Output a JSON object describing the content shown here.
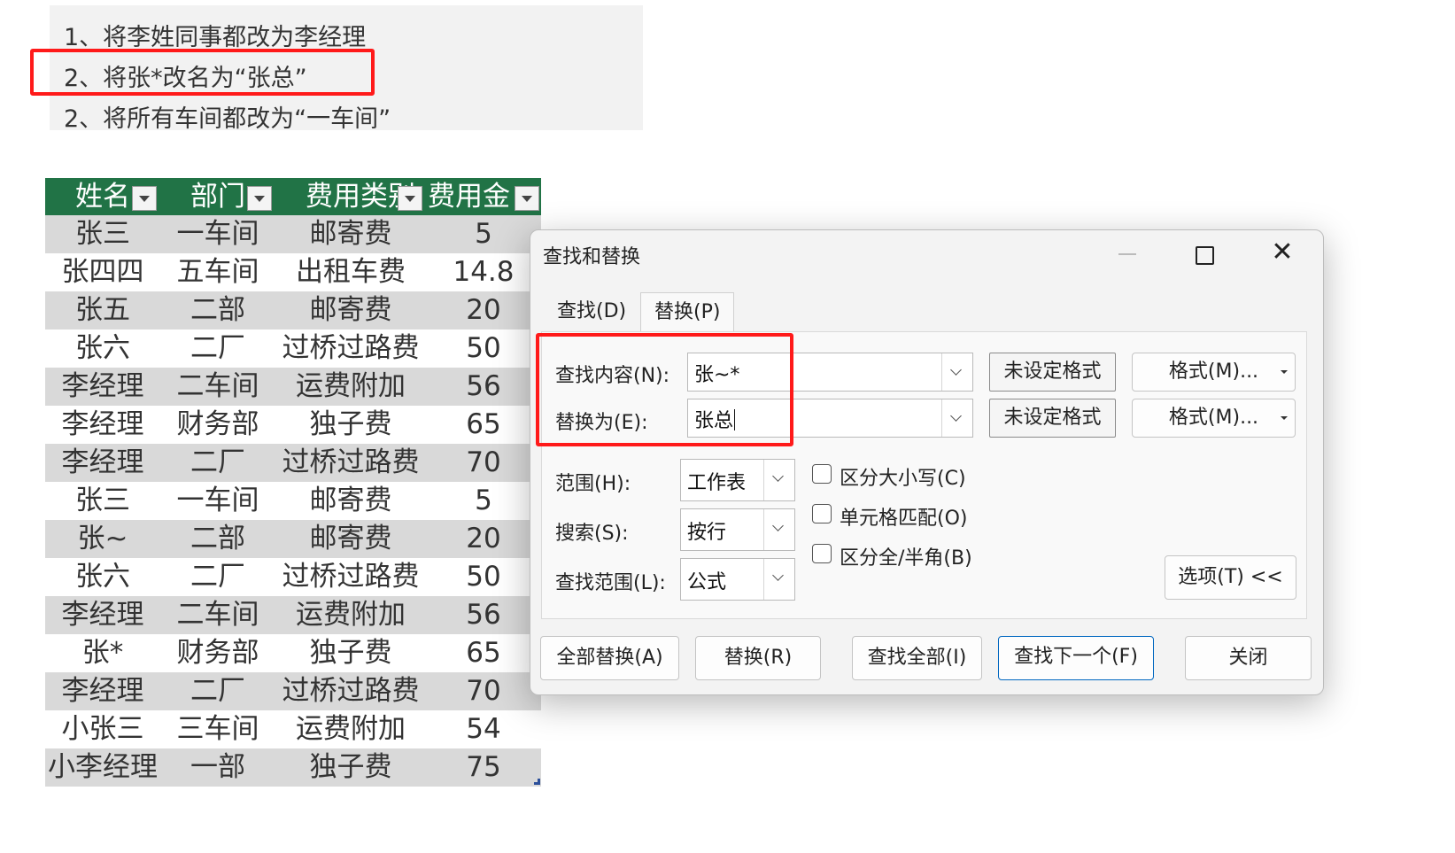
{
  "instructions": {
    "line1": "1、将李姓同事都改为李经理",
    "line2": "2、将张*改名为“张总”",
    "line3": "2、将所有车间都改为“一车间”"
  },
  "table": {
    "headers": [
      "姓名",
      "部门",
      "费用类别",
      "费用金"
    ],
    "rows": [
      [
        "张三",
        "一车间",
        "邮寄费",
        "5"
      ],
      [
        "张四四",
        "五车间",
        "出租车费",
        "14.8"
      ],
      [
        "张五",
        "二部",
        "邮寄费",
        "20"
      ],
      [
        "张六",
        "二厂",
        "过桥过路费",
        "50"
      ],
      [
        "李经理",
        "二车间",
        "运费附加",
        "56"
      ],
      [
        "李经理",
        "财务部",
        "独子费",
        "65"
      ],
      [
        "李经理",
        "二厂",
        "过桥过路费",
        "70"
      ],
      [
        "张三",
        "一车间",
        "邮寄费",
        "5"
      ],
      [
        "张~",
        "二部",
        "邮寄费",
        "20"
      ],
      [
        "张六",
        "二厂",
        "过桥过路费",
        "50"
      ],
      [
        "李经理",
        "二车间",
        "运费附加",
        "56"
      ],
      [
        "张*",
        "财务部",
        "独子费",
        "65"
      ],
      [
        "李经理",
        "二厂",
        "过桥过路费",
        "70"
      ],
      [
        "小张三",
        "三车间",
        "运费附加",
        "54"
      ],
      [
        "小李经理",
        "一部",
        "独子费",
        "75"
      ]
    ],
    "header_color": "#217346",
    "band_color": "#d9d9d9"
  },
  "dialog": {
    "title": "查找和替换",
    "tabs": {
      "find": "查找(D)",
      "replace": "替换(P)"
    },
    "find_label": "查找内容(N):",
    "find_value": "张~*",
    "replace_label": "替换为(E):",
    "replace_value": "张总",
    "no_format": "未设定格式",
    "format_button": "格式(M)...",
    "scope_label": "范围(H):",
    "scope_value": "工作表",
    "search_label": "搜索(S):",
    "search_value": "按行",
    "lookin_label": "查找范围(L):",
    "lookin_value": "公式",
    "match_case": "区分大小写(C)",
    "match_cell": "单元格匹配(O)",
    "match_width": "区分全/半角(B)",
    "options_button": "选项(T) <<",
    "replace_all": "全部替换(A)",
    "replace": "替换(R)",
    "find_all": "查找全部(I)",
    "find_next": "查找下一个(F)",
    "close": "关闭"
  },
  "colors": {
    "highlight": "#ff1a1a",
    "accent": "#0067c0"
  }
}
